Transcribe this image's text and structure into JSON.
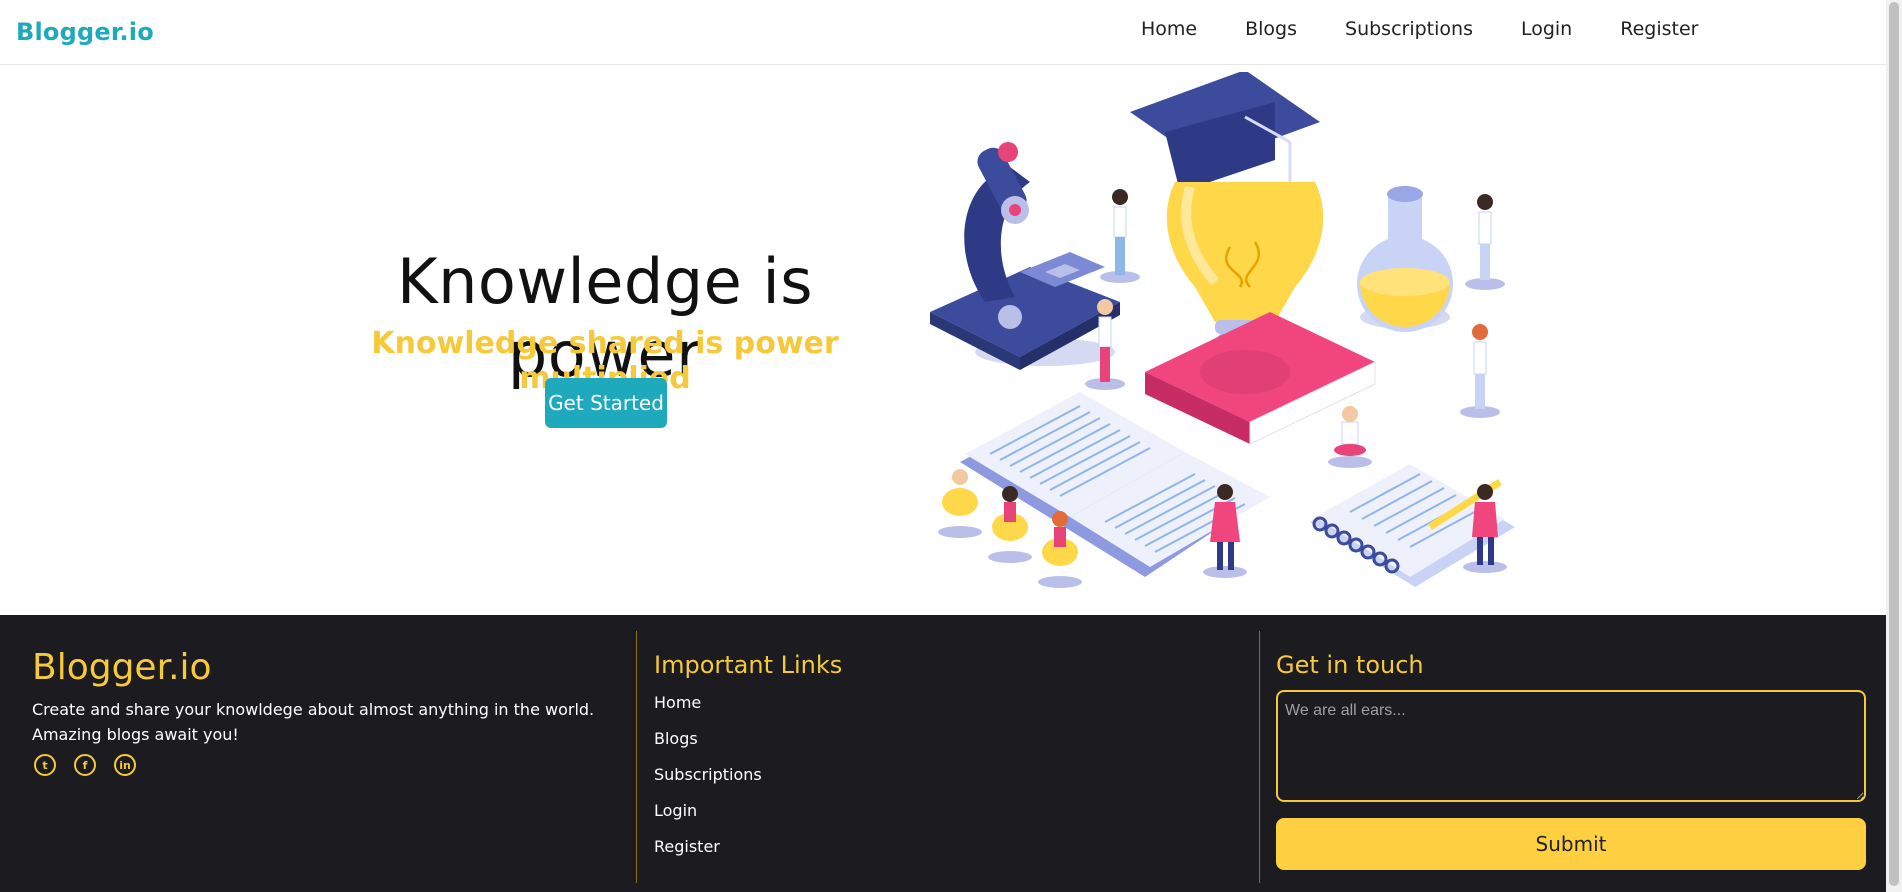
{
  "nav": {
    "brand": "Blogger.io",
    "links": [
      "Home",
      "Blogs",
      "Subscriptions",
      "Login",
      "Register"
    ]
  },
  "hero": {
    "title": "Knowledge is power",
    "subtitle": "Knowledge shared is power multiplied",
    "cta": "Get Started",
    "illustration_icon": "education-illustration"
  },
  "footer": {
    "brand": "Blogger.io",
    "description": "Create and share your knowldege about almost anything in the world. Amazing blogs await you!",
    "socials": [
      {
        "icon": "twitter-icon",
        "glyph": "t"
      },
      {
        "icon": "facebook-icon",
        "glyph": "f"
      },
      {
        "icon": "linkedin-icon",
        "glyph": "in"
      }
    ],
    "links_heading": "Important Links",
    "links": [
      "Home",
      "Blogs",
      "Subscriptions",
      "Login",
      "Register"
    ],
    "contact_heading": "Get in touch",
    "message_placeholder": "We are all ears...",
    "submit_label": "Submit"
  },
  "colors": {
    "brand": "#1fa9bd",
    "accent": "#f5c93a",
    "button_yellow": "#fecf41",
    "footer_bg": "#1c1b1f"
  }
}
